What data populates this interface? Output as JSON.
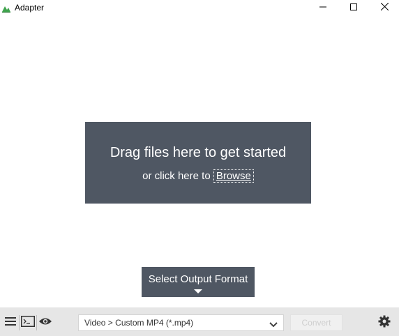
{
  "window": {
    "title": "Adapter",
    "controls": {
      "minimize": "minimize-icon",
      "maximize": "maximize-icon",
      "close": "close-icon"
    }
  },
  "dropzone": {
    "title": "Drag files here to get started",
    "subtitle_prefix": "or click here to ",
    "browse_label": "Browse"
  },
  "output_format_tab": {
    "label": "Select Output Format",
    "icon": "caret-down-icon"
  },
  "bottom_bar": {
    "left_icons": [
      "menu-icon",
      "terminal-icon",
      "eye-icon"
    ],
    "format_select": {
      "value": "Video > Custom MP4 (*.mp4)",
      "icon": "chevron-down-icon"
    },
    "convert_label": "Convert",
    "settings_icon": "gear-icon"
  },
  "colors": {
    "panel": "#4f5763",
    "bottom_bar": "#e6e6e6",
    "text_on_panel": "#ffffff"
  }
}
